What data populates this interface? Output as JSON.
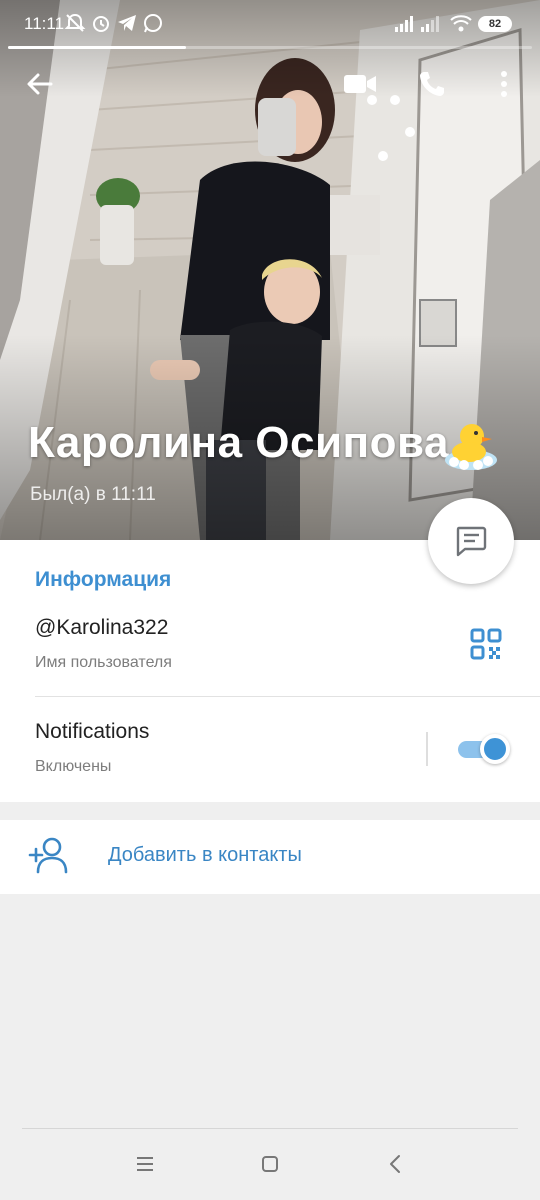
{
  "status_bar": {
    "time": "11:11",
    "battery": "82",
    "icons": [
      "mute-bell-icon",
      "alarm-icon",
      "telegram-icon",
      "whatsapp-icon",
      "signal-icon",
      "signal-icon",
      "wifi-icon",
      "battery-icon"
    ]
  },
  "story_progress": 0.34,
  "toolbar": {
    "icons": [
      "back-arrow-icon",
      "video-call-icon",
      "phone-icon",
      "more-vert-icon"
    ]
  },
  "profile": {
    "name": "Каролина Осипова",
    "last_seen": "Был(а) в 11:11",
    "emoji": "duck-in-bath-emoji"
  },
  "info": {
    "section_title": "Информация",
    "username": "@Karolina322",
    "username_caption": "Имя пользователя",
    "notifications_title": "Notifications",
    "notifications_status": "Включены",
    "notifications_enabled": true
  },
  "actions": {
    "add_contact": "Добавить в контакты"
  },
  "colors": {
    "accent": "#3e8fd1",
    "toggle_on": "#3e93d6",
    "background": "#efefef"
  },
  "nav": {
    "icons": [
      "menu-icon",
      "home-square-icon",
      "back-chevron-icon"
    ]
  }
}
